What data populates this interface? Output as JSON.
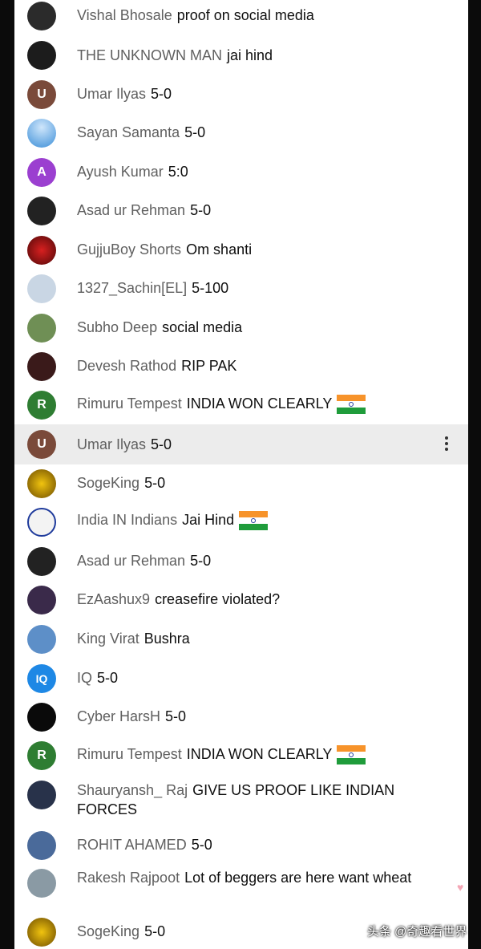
{
  "chat": {
    "messages": [
      {
        "author": "Vishal Bhosale",
        "text": "proof on social media",
        "avatar_color": "#2b2b2b",
        "avatar_letter": ""
      },
      {
        "author": "THE UNKNOWN MAN",
        "text": "jai hind",
        "avatar_color": "#1c1c1c",
        "avatar_letter": ""
      },
      {
        "author": "Umar Ilyas",
        "text": "5-0",
        "avatar_color": "#7a4a3a",
        "avatar_letter": "U"
      },
      {
        "author": "Sayan Samanta",
        "text": "5-0",
        "avatar_color": "#3d8fd8",
        "avatar_letter": ""
      },
      {
        "author": "Ayush Kumar",
        "text": "5:0",
        "avatar_color": "#9b3fd0",
        "avatar_letter": "A"
      },
      {
        "author": "Asad ur Rehman",
        "text": "5-0",
        "avatar_color": "#222222",
        "avatar_letter": ""
      },
      {
        "author": "GujjuBoy Shorts",
        "text": "Om shanti",
        "avatar_color": "#a01010",
        "avatar_letter": ""
      },
      {
        "author": "1327_Sachin[EL]",
        "text": "5-100",
        "avatar_color": "#c9d6e4",
        "avatar_letter": ""
      },
      {
        "author": "Subho Deep",
        "text": "social media",
        "avatar_color": "#6f8f55",
        "avatar_letter": ""
      },
      {
        "author": "Devesh Rathod",
        "text": "RIP PAK",
        "avatar_color": "#3a1a1a",
        "avatar_letter": ""
      },
      {
        "author": "Rimuru Tempest",
        "text": "INDIA WON CLEARLY",
        "avatar_color": "#2e7d32",
        "avatar_letter": "R",
        "flag": true
      },
      {
        "author": "Umar Ilyas",
        "text": "5-0",
        "avatar_color": "#7a4a3a",
        "avatar_letter": "U",
        "highlight": true
      },
      {
        "author": "SogeKing",
        "text": "5-0",
        "avatar_color": "#c79a1c",
        "avatar_letter": ""
      },
      {
        "author": "India IN Indians",
        "text": "Jai Hind",
        "avatar_color": "#f3f3f3",
        "avatar_letter": "",
        "flag": true
      },
      {
        "author": "Asad ur Rehman",
        "text": "5-0",
        "avatar_color": "#222222",
        "avatar_letter": ""
      },
      {
        "author": "EzAashux9",
        "text": "creasefire violated?",
        "avatar_color": "#3a2a4a",
        "avatar_letter": ""
      },
      {
        "author": "King Virat",
        "text": "Bushra",
        "avatar_color": "#5d8fc8",
        "avatar_letter": ""
      },
      {
        "author": "IQ",
        "text": "5-0",
        "avatar_color": "#1e88e5",
        "avatar_letter": "IQ"
      },
      {
        "author": "Cyber HarsH",
        "text": "5-0",
        "avatar_color": "#0a0a0a",
        "avatar_letter": ""
      },
      {
        "author": "Rimuru Tempest",
        "text": "INDIA WON CLEARLY",
        "avatar_color": "#2e7d32",
        "avatar_letter": "R",
        "flag": true
      },
      {
        "author": "Shauryansh_ Raj",
        "text": "GIVE US PROOF LIKE INDIAN FORCES",
        "avatar_color": "#28324a",
        "avatar_letter": ""
      },
      {
        "author": "ROHIT AHAMED",
        "text": "5-0",
        "avatar_color": "#4a6a9a",
        "avatar_letter": ""
      },
      {
        "author": "Rakesh Rajpoot",
        "text": "Lot of beggers are here want wheat",
        "avatar_color": "#8a9aa4",
        "avatar_letter": ""
      },
      {
        "author": "SogeKing",
        "text": "5-0",
        "avatar_color": "#c79a1c",
        "avatar_letter": ""
      }
    ]
  },
  "watermark": "头条 @奇趣看世界"
}
